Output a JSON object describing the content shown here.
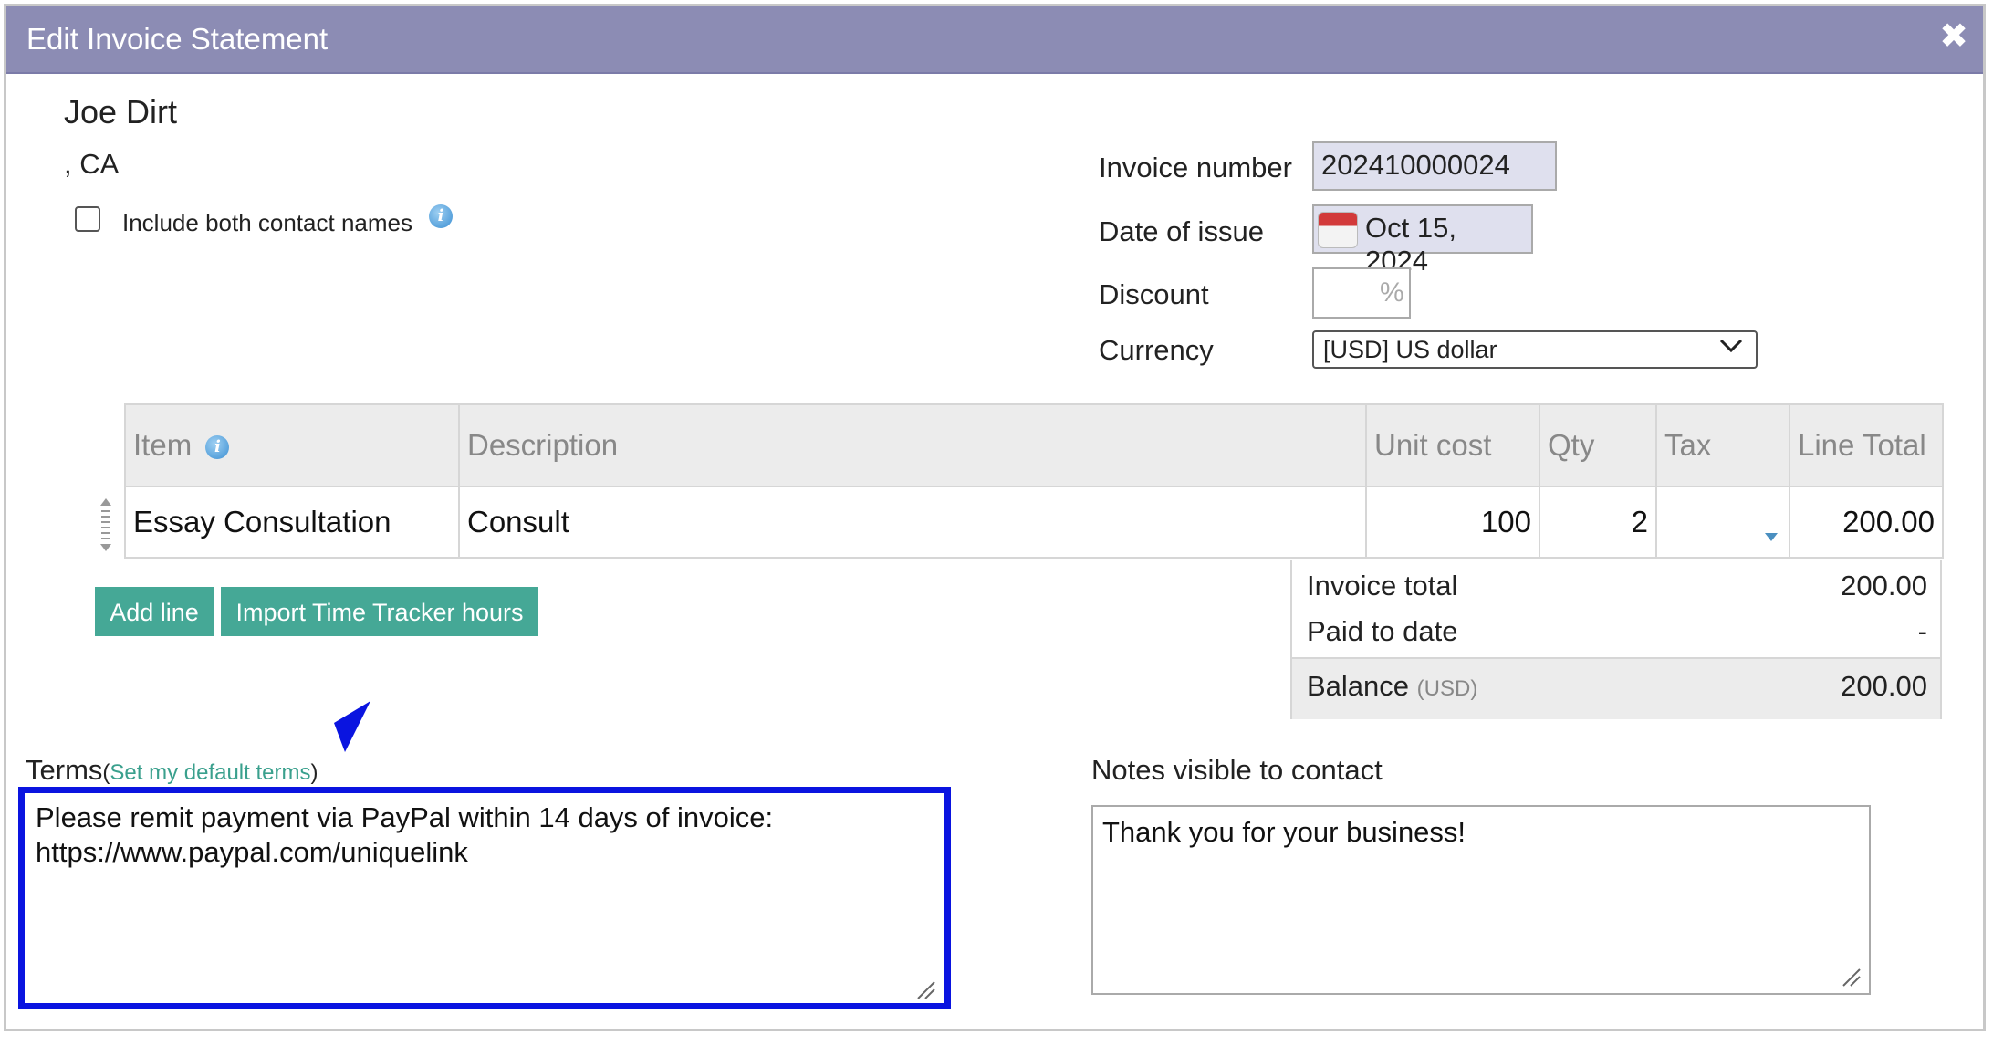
{
  "dialog": {
    "title": "Edit Invoice Statement",
    "close_icon": "✖"
  },
  "contact": {
    "name": "Joe Dirt",
    "address": ", CA",
    "include_both_label": "Include both contact names",
    "include_both_checked": false
  },
  "invoice": {
    "number_label": "Invoice number",
    "number_value": "202410000024",
    "date_label": "Date of issue",
    "date_value": "Oct 15, 2024",
    "discount_label": "Discount",
    "discount_value": "",
    "discount_suffix": "%",
    "currency_label": "Currency",
    "currency_value": "[USD] US dollar"
  },
  "items_table": {
    "headers": [
      "Item",
      "Description",
      "Unit cost",
      "Qty",
      "Tax",
      "Line Total"
    ],
    "rows": [
      {
        "item": "Essay Consultation",
        "description": "Consult",
        "unit_cost": "100",
        "qty": "2",
        "tax": "",
        "line_total": "200.00"
      }
    ]
  },
  "buttons": {
    "add_line": "Add line",
    "import_hours": "Import Time Tracker hours"
  },
  "totals": {
    "invoice_total_label": "Invoice total",
    "invoice_total_value": "200.00",
    "paid_label": "Paid to date",
    "paid_value": "-",
    "balance_label": "Balance",
    "balance_currency": "(USD)",
    "balance_value": "200.00"
  },
  "terms": {
    "label": "Terms",
    "open_paren": "(",
    "link": "Set my default terms",
    "close_paren": ")",
    "text": "Please remit payment via PayPal within 14 days of invoice:\nhttps://www.paypal.com/uniquelink"
  },
  "notes": {
    "label": "Notes visible to contact",
    "text": "Thank you for your business!"
  },
  "colors": {
    "titlebar": "#8c8cb4",
    "button": "#45a896",
    "highlight": "#0a14e0"
  }
}
